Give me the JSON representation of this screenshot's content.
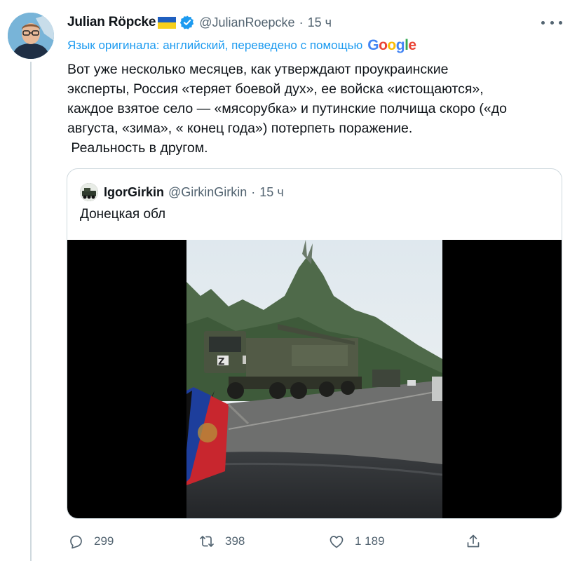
{
  "author": {
    "display_name": "Julian Röpcke",
    "handle": "@JulianRoepcke",
    "time": "15 ч",
    "dot": "·",
    "verified": true,
    "flag": "ukraine-flag"
  },
  "translation": {
    "label": "Язык оригинала: английский, переведено с помощью",
    "provider": "Google"
  },
  "tweet": {
    "lines": [
      "Вот уже несколько месяцев, как утверждают проукраинские",
      "эксперты, Россия «теряет боевой дух», ее войска «истощаются»,",
      "каждое взятое село — «мясорубка» и путинские полчища скоро («до",
      "августа, «зима», « конец года») потерпеть поражение.",
      " Реальность в другом."
    ]
  },
  "quoted": {
    "display_name": "IgorGirkin",
    "handle": "@GirkinGirkin",
    "dot": "·",
    "time": "15 ч",
    "text": "Донецкая обл"
  },
  "actions": {
    "replies": "299",
    "retweets": "398",
    "likes": "1 189"
  },
  "colors": {
    "accent": "#1d9bf0",
    "secondary_text": "#536471",
    "border": "#cfd9de"
  }
}
